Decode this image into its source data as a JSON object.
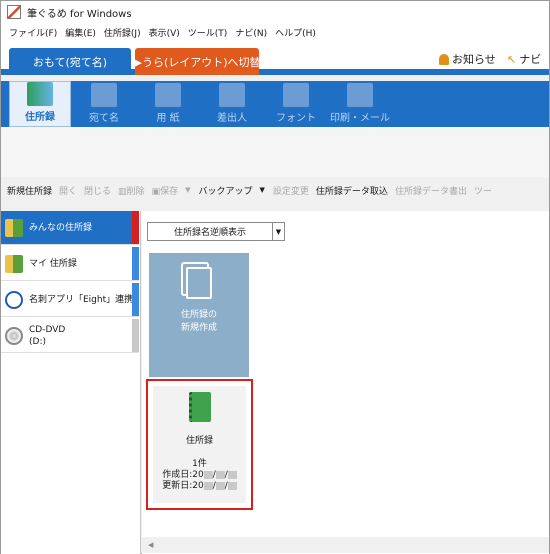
{
  "window": {
    "title": "筆ぐるめ for Windows"
  },
  "menu": [
    "ファイル(F)",
    "編集(E)",
    "住所録(J)",
    "表示(V)",
    "ツール(T)",
    "ナビ(N)",
    "ヘルプ(H)"
  ],
  "tabs": {
    "front": "おもて(宛て名)",
    "back": "▶うら(レイアウト)へ切替"
  },
  "header_links": {
    "news": "お知らせ",
    "navi": "ナビ"
  },
  "ribbon": [
    {
      "label": "住所録",
      "icon": "address-book-icon",
      "active": true
    },
    {
      "label": "宛て名",
      "icon": "addressee-icon",
      "active": false
    },
    {
      "label": "用 紙",
      "icon": "paper-icon",
      "active": false
    },
    {
      "label": "差出人",
      "icon": "sender-icon",
      "active": false
    },
    {
      "label": "フォント",
      "icon": "font-icon",
      "active": false
    },
    {
      "label": "印刷・メール",
      "icon": "printer-icon",
      "active": false
    }
  ],
  "toolbar": {
    "new_book": "新規住所録",
    "open": "開く",
    "close": "閉じる",
    "delete": "削除",
    "save": "保存",
    "backup": "バックアップ",
    "settings": "設定変更",
    "import": "住所録データ取込",
    "export": "住所録データ書出",
    "overflow": "ツー"
  },
  "left_pane": [
    {
      "label": "みんなの住所録",
      "icon": "shared-book-icon",
      "selected": true
    },
    {
      "label": "マイ 住所録",
      "icon": "my-book-icon",
      "selected": false
    },
    {
      "label": "名刺アプリ「Eight」連携",
      "icon": "eight-logo-icon",
      "selected": false
    },
    {
      "label": "CD-DVD\n(D:)",
      "line1": "CD-DVD",
      "line2": "(D:)",
      "icon": "disc-icon",
      "selected": false
    }
  ],
  "main": {
    "sort_option": "住所録名逆順表示",
    "new_card": {
      "line1": "住所録の",
      "line2": "新規作成"
    },
    "book_card": {
      "name": "住所録",
      "count": "1件",
      "created_prefix": "作成日:20",
      "updated_prefix": "更新日:20",
      "separator": "/"
    }
  },
  "scroll": {
    "left_arrow": "◀"
  }
}
